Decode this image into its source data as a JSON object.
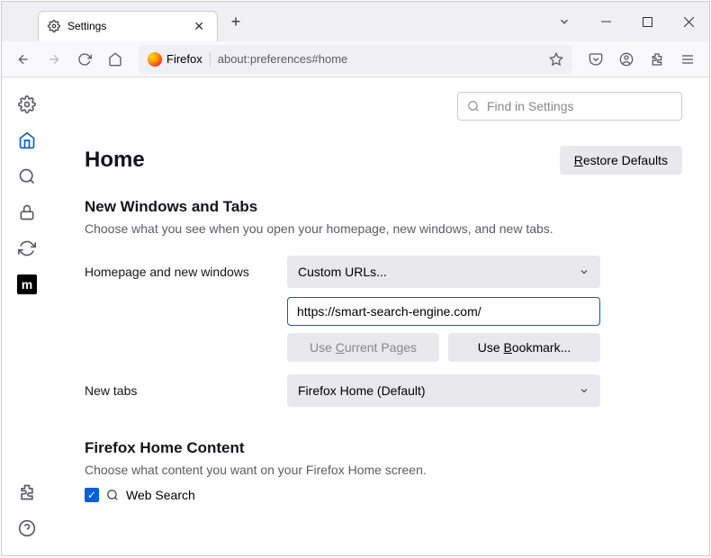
{
  "window": {
    "tab_title": "Settings",
    "url": "about:preferences#home",
    "url_identity": "Firefox"
  },
  "search": {
    "placeholder": "Find in Settings"
  },
  "heading": "Home",
  "restore_btn": "Restore Defaults",
  "nwt": {
    "title": "New Windows and Tabs",
    "desc": "Choose what you see when you open your homepage, new windows, and new tabs.",
    "homepage_label": "Homepage and new windows",
    "homepage_select": "Custom URLs...",
    "homepage_value": "https://smart-search-engine.com/",
    "use_current": "Use Current Pages",
    "use_bookmark": "Use Bookmark...",
    "newtabs_label": "New tabs",
    "newtabs_select": "Firefox Home (Default)"
  },
  "fhc": {
    "title": "Firefox Home Content",
    "desc": "Choose what content you want on your Firefox Home screen.",
    "websearch": "Web Search"
  }
}
